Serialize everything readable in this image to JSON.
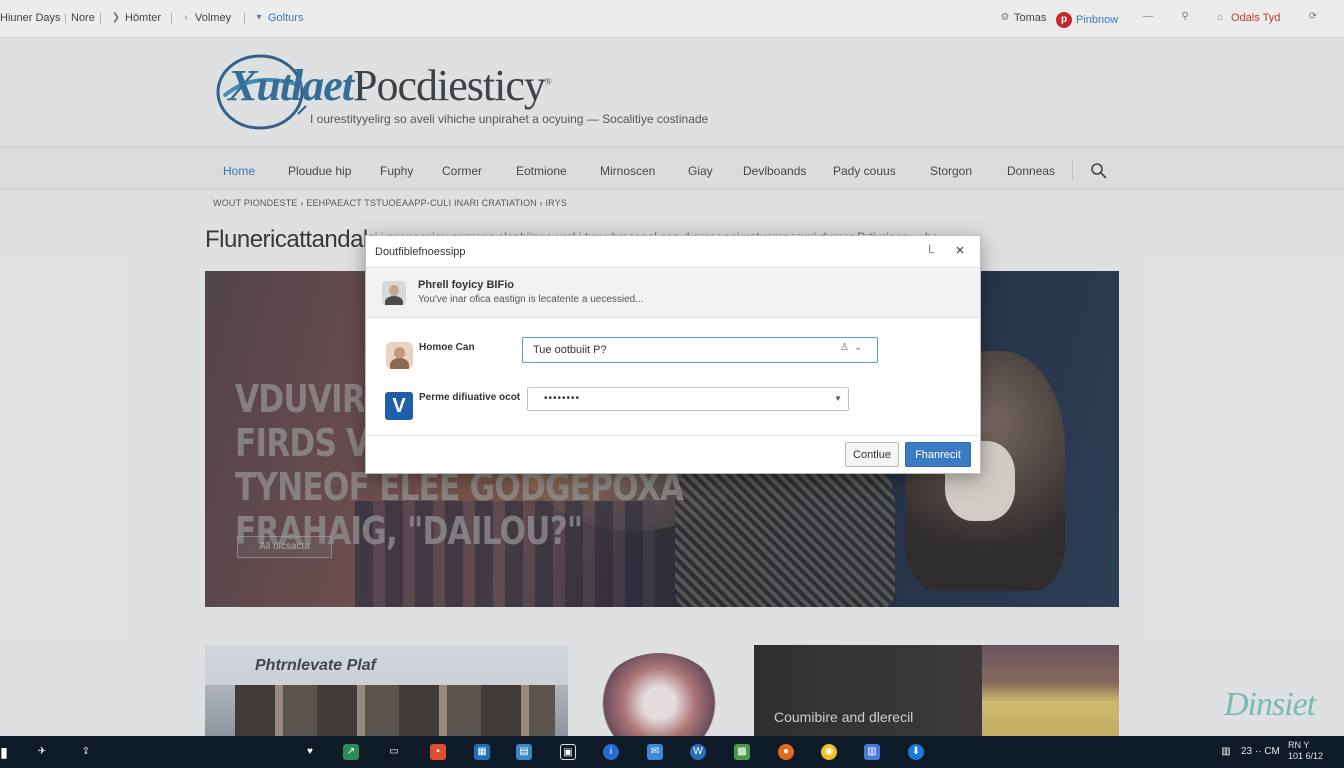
{
  "topbar": {
    "left": [
      {
        "label": "Hiuner Days"
      },
      {
        "label": "Nore"
      },
      {
        "label": "Hömter",
        "icon": "twitter-icon"
      },
      {
        "label": "Volmey",
        "icon": "chevron-left-icon"
      },
      {
        "label": "Golturs",
        "icon": "bookmark-icon"
      }
    ],
    "right": [
      {
        "label": "Tomas",
        "icon": "gear-icon"
      },
      {
        "label": "Pinbnow",
        "icon": "pinterest-icon"
      },
      {
        "label": "",
        "icon": "minus-icon"
      },
      {
        "label": "",
        "icon": "user-icon"
      },
      {
        "label": "Odals Tyd",
        "icon": "home-icon"
      },
      {
        "label": "",
        "icon": "refresh-icon"
      }
    ],
    "pin_letter": "p"
  },
  "brand": {
    "logo_part1": "Xutlaet",
    "logo_part2": "Pocdiesticy",
    "trademark": "®",
    "tagline": "I ourestityyelirg so aveli vihiche unpirahet a ocyuing — Socalitiye costinade"
  },
  "nav": {
    "items": [
      "Home",
      "Ploudue hip",
      "Fuphy",
      "Cormer",
      "Eotmione",
      "Mirnoscen",
      "Giay",
      "Devlboands",
      "Pady couus",
      "Storgon",
      "Donneas"
    ],
    "active_index": 0
  },
  "breadcrumb": "WOUT PIONDESTE  ›  EEHPAEACT  TSTUOEAAPP-CULI INARI CRATIATION  ›  IRYS",
  "page": {
    "title": "Flunericattandal",
    "title_tail": "ai i oocnocoieu conroos elopbiinee urel i tuu uhmaseol coo d arcor ooi uetuemnaruui dumar Drtiurinco ... ha"
  },
  "hero": {
    "headline": [
      "VDUVIR 6",
      "FIRDS VO",
      "TYNEOF ELEE GODGEPOXA",
      "FRAHAIG, \"DAILOU?\""
    ],
    "button_label": "All oicsacta"
  },
  "cards": [
    {
      "label": "Phtrnlevate Plaf"
    },
    {
      "label": ""
    },
    {
      "label": "Coumibire and dlerecil"
    }
  ],
  "watermark": "Dinsiet",
  "modal": {
    "title": "Doutfiblefnoessipp",
    "minimize_label": "L",
    "close_label": "×",
    "info": {
      "title": "Phrell foyicy BIFio",
      "subtitle": "You've inar ofica eastign is lecatente a uecessied..."
    },
    "field1": {
      "label": "Homoe Can",
      "value": "Tue ootbuiit P?"
    },
    "field2": {
      "label": "Perme difiuative ocot",
      "value": "••••••••",
      "badge": "V"
    },
    "cancel_label": "Contlue",
    "submit_label": "Fhanrecit"
  },
  "taskbar": {
    "clock": "23 ·· CM",
    "date_line1": "RN Y",
    "date_line2": "101 6/12"
  },
  "colors": {
    "accent": "#3b7bc4",
    "nav_active": "#3a7ab4",
    "taskbar": "#0f1a28"
  }
}
